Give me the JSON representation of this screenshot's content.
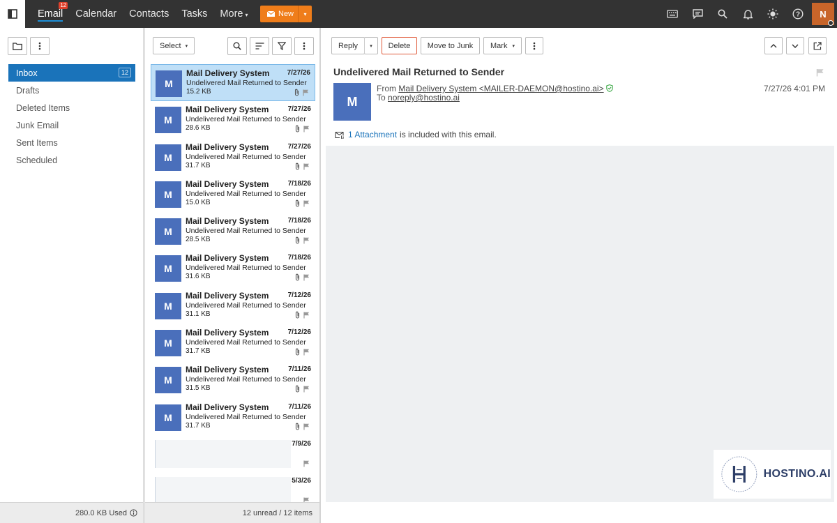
{
  "topbar": {
    "nav": [
      {
        "label": "Email",
        "badge": "12",
        "active": true
      },
      {
        "label": "Calendar"
      },
      {
        "label": "Contacts"
      },
      {
        "label": "Tasks"
      },
      {
        "label": "More"
      }
    ],
    "new_label": "New",
    "user_initial": "N"
  },
  "folders": {
    "items": [
      {
        "label": "Inbox",
        "count": "12",
        "selected": true
      },
      {
        "label": "Drafts"
      },
      {
        "label": "Deleted Items"
      },
      {
        "label": "Junk Email"
      },
      {
        "label": "Sent Items"
      },
      {
        "label": "Scheduled"
      }
    ],
    "storage_used": "280.0 KB Used"
  },
  "list": {
    "select_label": "Select",
    "footer": "12 unread / 12 items",
    "messages": [
      {
        "initial": "M",
        "sender": "Mail Delivery System",
        "subject": "Undelivered Mail Returned to Sender",
        "size": "15.2 KB",
        "date": "7/27/26",
        "selected": true
      },
      {
        "initial": "M",
        "sender": "Mail Delivery System",
        "subject": "Undelivered Mail Returned to Sender",
        "size": "28.6 KB",
        "date": "7/27/26"
      },
      {
        "initial": "M",
        "sender": "Mail Delivery System",
        "subject": "Undelivered Mail Returned to Sender",
        "size": "31.7 KB",
        "date": "7/27/26"
      },
      {
        "initial": "M",
        "sender": "Mail Delivery System",
        "subject": "Undelivered Mail Returned to Sender",
        "size": "15.0 KB",
        "date": "7/18/26"
      },
      {
        "initial": "M",
        "sender": "Mail Delivery System",
        "subject": "Undelivered Mail Returned to Sender",
        "size": "28.5 KB",
        "date": "7/18/26"
      },
      {
        "initial": "M",
        "sender": "Mail Delivery System",
        "subject": "Undelivered Mail Returned to Sender",
        "size": "31.6 KB",
        "date": "7/18/26"
      },
      {
        "initial": "M",
        "sender": "Mail Delivery System",
        "subject": "Undelivered Mail Returned to Sender",
        "size": "31.1 KB",
        "date": "7/12/26"
      },
      {
        "initial": "M",
        "sender": "Mail Delivery System",
        "subject": "Undelivered Mail Returned to Sender",
        "size": "31.7 KB",
        "date": "7/12/26"
      },
      {
        "initial": "M",
        "sender": "Mail Delivery System",
        "subject": "Undelivered Mail Returned to Sender",
        "size": "31.5 KB",
        "date": "7/11/26"
      },
      {
        "initial": "M",
        "sender": "Mail Delivery System",
        "subject": "Undelivered Mail Returned to Sender",
        "size": "31.7 KB",
        "date": "7/11/26"
      },
      {
        "date": "7/9/26",
        "placeholder": true
      },
      {
        "date": "5/3/26",
        "placeholder": true
      }
    ]
  },
  "reader": {
    "toolbar": {
      "reply": "Reply",
      "delete": "Delete",
      "move_to_junk": "Move to Junk",
      "mark": "Mark"
    },
    "subject": "Undelivered Mail Returned to Sender",
    "avatar_initial": "M",
    "from_label": "From",
    "from_value": "Mail Delivery System <MAILER-DAEMON@hostino.ai>",
    "to_label": "To",
    "to_value": "noreply@hostino.ai",
    "date": "7/27/26 4:01 PM",
    "attachment_link": "1 Attachment",
    "attachment_text": "is included with this email.",
    "logo_text": "HOSTINO.AI"
  },
  "colors": {
    "topbar": "#333333",
    "accent": "#1a73ba",
    "new_button": "#ef7d1a",
    "avatar": "#4a6fbb",
    "user_avatar": "#c8652a"
  }
}
